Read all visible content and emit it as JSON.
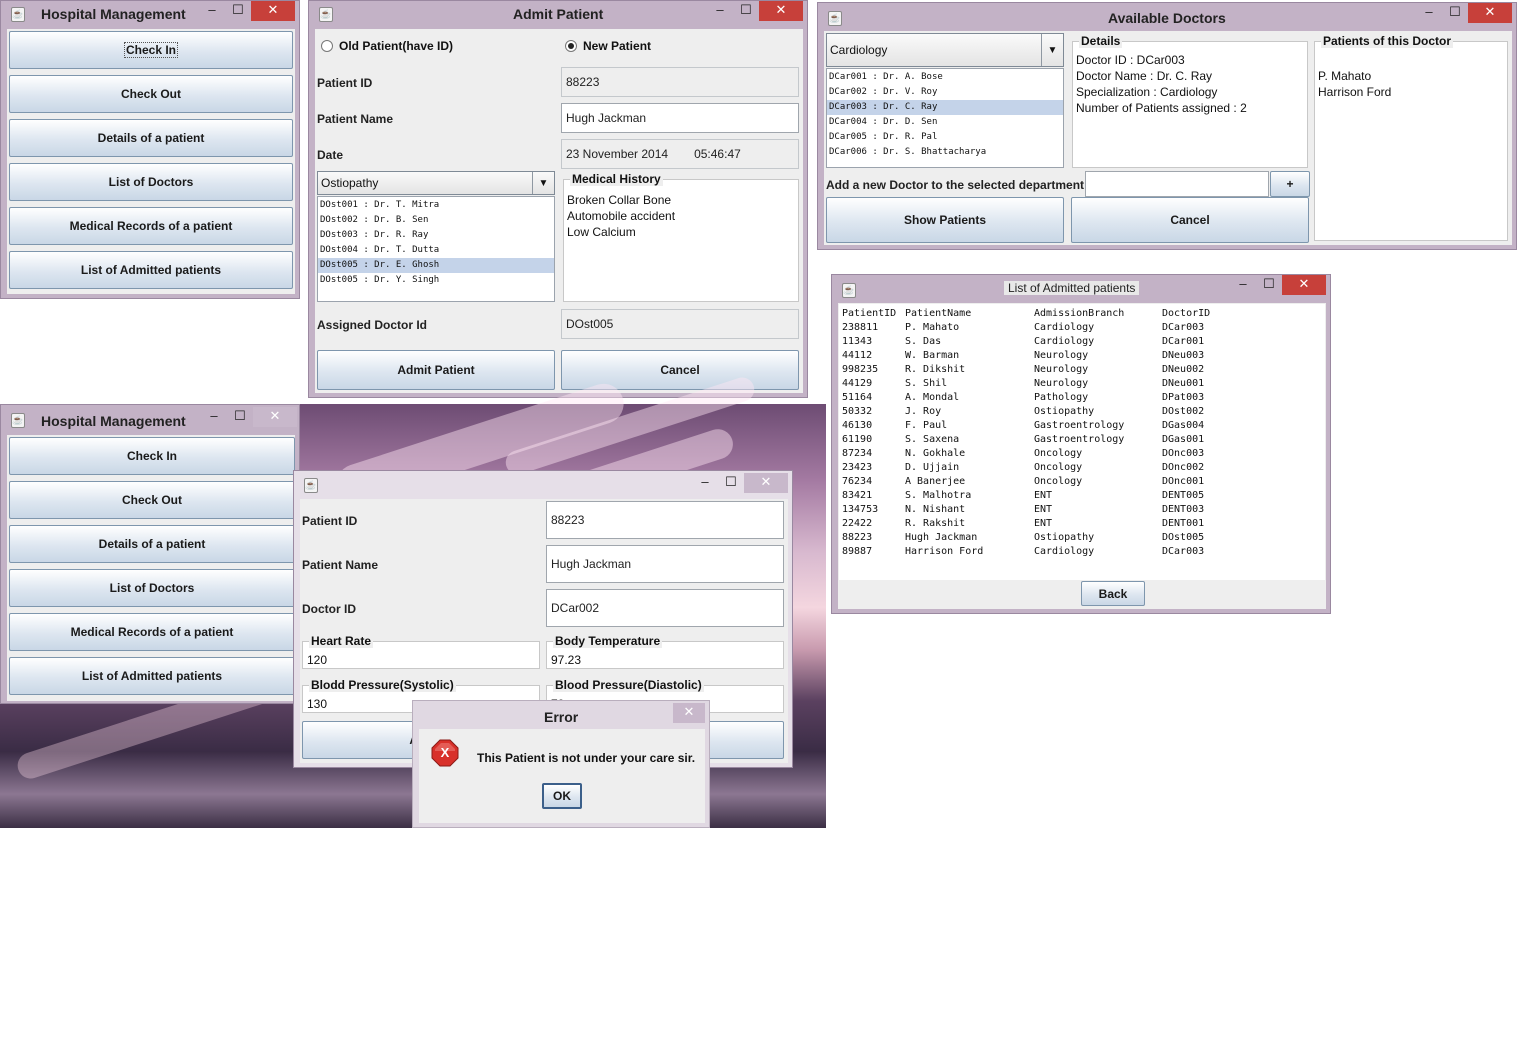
{
  "hm1": {
    "title": "Hospital Management",
    "buttons": [
      "Check In",
      "Check Out",
      "Details of a patient",
      "List of Doctors",
      "Medical Records of a patient",
      "List of Admitted patients"
    ]
  },
  "admit": {
    "title": "Admit Patient",
    "radio_old": "Old Patient(have ID)",
    "radio_new": "New Patient",
    "patient_id_label": "Patient ID",
    "patient_id": "88223",
    "patient_name_label": "Patient Name",
    "patient_name": "Hugh Jackman",
    "date_label": "Date",
    "date": "23 November 2014",
    "time": "05:46:47",
    "department": "Ostiopathy",
    "doctors": [
      "DOst001 : Dr. T. Mitra",
      "DOst002 : Dr. B. Sen",
      "DOst003 : Dr. R. Ray",
      "DOst004 : Dr. T. Dutta",
      "DOst005 : Dr. E. Ghosh",
      "DOst005 : Dr. Y. Singh"
    ],
    "selected_doctor_index": 4,
    "history_title": "Medical History",
    "history": [
      "Broken Collar Bone",
      "Automobile accident",
      "Low Calcium"
    ],
    "assigned_label": "Assigned Doctor Id",
    "assigned": "DOst005",
    "admit_button": "Admit Patient",
    "cancel_button": "Cancel"
  },
  "avail": {
    "title": "Available Doctors",
    "department": "Cardiology",
    "doctors": [
      "DCar001 : Dr. A. Bose",
      "DCar002 : Dr. V. Roy",
      "DCar003 : Dr. C. Ray",
      "DCar004 : Dr. D. Sen",
      "DCar005 : Dr. R. Pal",
      "DCar006 : Dr. S. Bhattacharya"
    ],
    "selected_doctor_index": 2,
    "details_title": "Details",
    "details": [
      "Doctor ID : DCar003",
      "Doctor Name : Dr. C. Ray",
      "Specialization : Cardiology",
      "Number of Patients assigned : 2"
    ],
    "patients_title": "Patients of this Doctor",
    "patients": [
      "P. Mahato",
      "Harrison Ford"
    ],
    "add_label": "Add a new Doctor to the selected department",
    "add_value": "",
    "plus_button": "+",
    "show_button": "Show Patients",
    "cancel_button": "Cancel"
  },
  "admitted": {
    "title": "List of Admitted patients",
    "headers": [
      "PatientID",
      "PatientName",
      "AdmissionBranch",
      "DoctorID"
    ],
    "rows": [
      [
        "238811",
        "P. Mahato",
        "Cardiology",
        "DCar003"
      ],
      [
        "11343",
        "S. Das",
        "Cardiology",
        "DCar001"
      ],
      [
        "44112",
        "W. Barman",
        "Neurology",
        "DNeu003"
      ],
      [
        "998235",
        "R. Dikshit",
        "Neurology",
        "DNeu002"
      ],
      [
        "44129",
        "S. Shil",
        "Neurology",
        "DNeu001"
      ],
      [
        "51164",
        "A. Mondal",
        "Pathology",
        "DPat003"
      ],
      [
        "50332",
        "J. Roy",
        "Ostiopathy",
        "DOst002"
      ],
      [
        "46130",
        "F. Paul",
        "Gastroentrology",
        "DGas004"
      ],
      [
        "61190",
        "S. Saxena",
        "Gastroentrology",
        "DGas001"
      ],
      [
        "87234",
        "N. Gokhale",
        "Oncology",
        "DOnc003"
      ],
      [
        "23423",
        "D. Ujjain",
        "Oncology",
        "DOnc002"
      ],
      [
        "76234",
        "A Banerjee",
        "Oncology",
        "DOnc001"
      ],
      [
        "83421",
        "S. Malhotra",
        "ENT",
        "DENT005"
      ],
      [
        "134753",
        "N. Nishant",
        "ENT",
        "DENT003"
      ],
      [
        "22422",
        "R. Rakshit",
        "ENT",
        "DENT001"
      ],
      [
        "88223",
        "Hugh Jackman",
        "Ostiopathy",
        "DOst005"
      ],
      [
        "89887",
        "Harrison Ford",
        "Cardiology",
        "DCar003"
      ]
    ],
    "back_button": "Back"
  },
  "hm2": {
    "title": "Hospital Management",
    "buttons": [
      "Check In",
      "Check Out",
      "Details of a patient",
      "List of Doctors",
      "Medical Records of a patient",
      "List of Admitted patients"
    ]
  },
  "record": {
    "patient_id_label": "Patient ID",
    "patient_id": "88223",
    "patient_name_label": "Patient Name",
    "patient_name": "Hugh Jackman",
    "doctor_id_label": "Doctor ID",
    "doctor_id": "DCar002",
    "heart_rate_title": "Heart Rate",
    "heart_rate": "120",
    "body_temp_title": "Body Temperature",
    "body_temp": "97.23",
    "bp_sys_title": "Blodd Pressure(Systolic)",
    "bp_sys": "130",
    "bp_dia_title": "Blood Pressure(Diastolic)",
    "bp_dia": "70",
    "add_button": "Add"
  },
  "error": {
    "title": "Error",
    "message": "This Patient is not under your care sir.",
    "ok_button": "OK"
  },
  "glyphs": {
    "minimize": "–",
    "maximize": "☐",
    "close": "✕",
    "dropdown": "▼",
    "java": "☕",
    "error": "X"
  }
}
